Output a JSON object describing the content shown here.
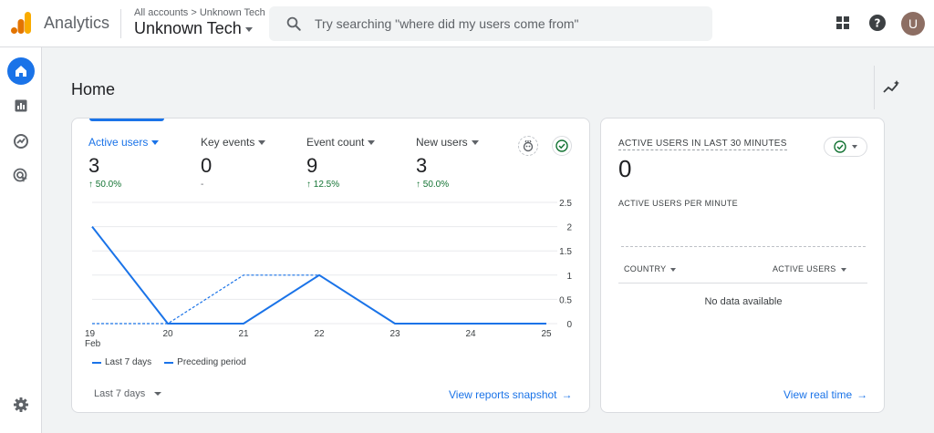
{
  "header": {
    "app_name": "Analytics",
    "breadcrumb": "All accounts > Unknown Tech",
    "property_name": "Unknown Tech",
    "search_placeholder": "Try searching \"where did my users come from\"",
    "avatar_initial": "U"
  },
  "page": {
    "title": "Home"
  },
  "metrics": [
    {
      "label": "Active users",
      "value": "3",
      "change": "↑ 50.0%",
      "active": true
    },
    {
      "label": "Key events",
      "value": "0",
      "change": "-",
      "active": false
    },
    {
      "label": "Event count",
      "value": "9",
      "change": "↑ 12.5%",
      "active": false
    },
    {
      "label": "New users",
      "value": "3",
      "change": "↑ 50.0%",
      "active": false
    }
  ],
  "chart_data": {
    "type": "line",
    "x": [
      "19",
      "20",
      "21",
      "22",
      "23",
      "24",
      "25"
    ],
    "x_sublabel": "Feb",
    "y_ticks": [
      "2.5",
      "2",
      "1.5",
      "1",
      "0.5",
      "0"
    ],
    "ylim": [
      0,
      2.5
    ],
    "series": [
      {
        "name": "Last 7 days",
        "style": "solid",
        "values": [
          2,
          0,
          0,
          1,
          0,
          0,
          0
        ]
      },
      {
        "name": "Preceding period",
        "style": "dashed",
        "values": [
          0,
          0,
          1,
          1,
          0,
          0,
          0
        ]
      }
    ],
    "color": "#1a73e8"
  },
  "main_card": {
    "date_range": "Last 7 days",
    "link": "View reports snapshot",
    "link_arrow": "→"
  },
  "realtime": {
    "title": "ACTIVE USERS IN LAST 30 MINUTES",
    "value": "0",
    "sub_title": "ACTIVE USERS PER MINUTE",
    "col_country": "COUNTRY",
    "col_users": "ACTIVE USERS",
    "empty": "No data available",
    "link": "View real time",
    "link_arrow": "→"
  },
  "colors": {
    "accent": "#1a73e8",
    "positive": "#137333",
    "logo_orange": "#f9ab00",
    "logo_dark": "#e37400"
  }
}
